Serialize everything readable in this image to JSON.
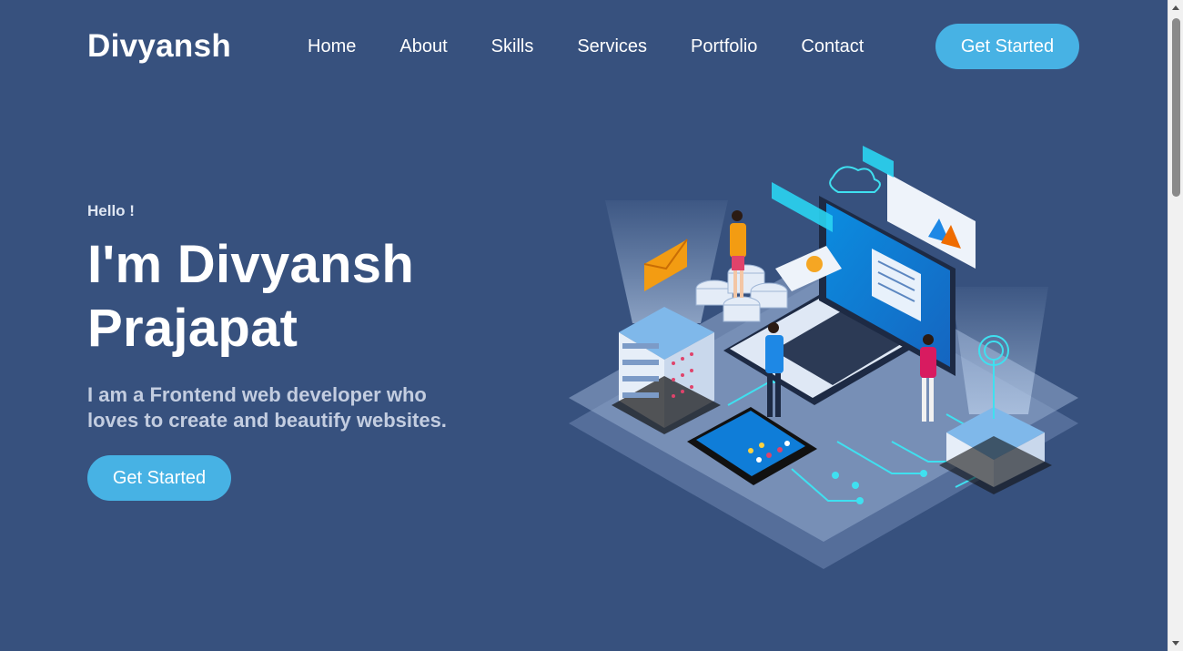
{
  "header": {
    "logo": "Divyansh",
    "nav": [
      "Home",
      "About",
      "Skills",
      "Services",
      "Portfolio",
      "Contact"
    ],
    "cta_label": "Get Started"
  },
  "hero": {
    "greeting": "Hello !",
    "title_line1": "I'm Divyansh",
    "title_line2": "Prajapat",
    "tagline": "I am a Frontend web developer who loves to create and beautify websites.",
    "cta_label": "Get Started",
    "illustration_icon": "tech-isometric-illustration"
  },
  "colors": {
    "background": "#37517e",
    "accent": "#47b2e4",
    "muted_text": "#c3cde0"
  }
}
